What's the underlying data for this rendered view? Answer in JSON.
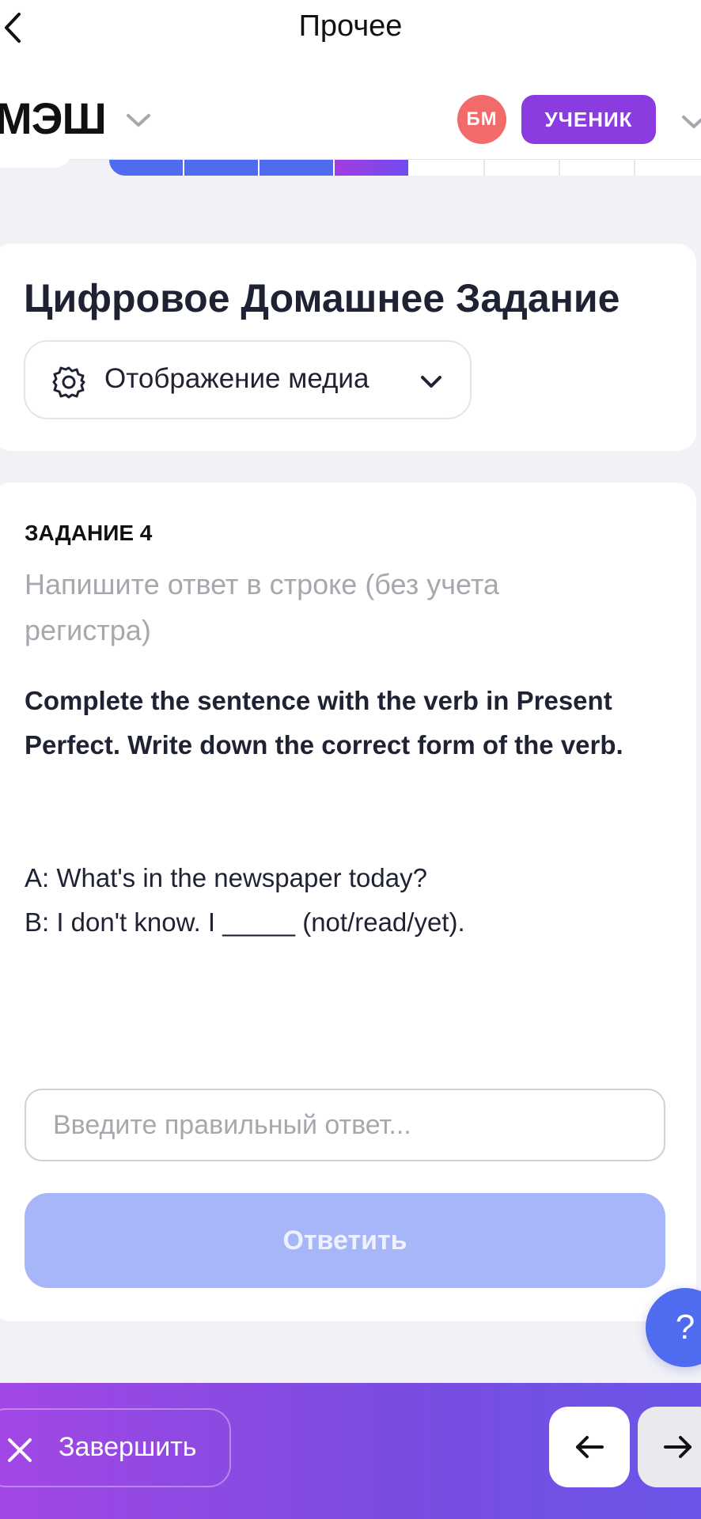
{
  "nav": {
    "title": "Прочее",
    "back_icon": "chevron-left-icon"
  },
  "header": {
    "logo_text": "МЭШ",
    "avatar_initials": "БМ",
    "role_label": "УЧЕНИК",
    "colors": {
      "avatar": "#F26A6A",
      "role_badge": "#8B3CE0"
    }
  },
  "progress": {
    "segments": [
      "done",
      "done",
      "done",
      "current",
      "todo",
      "todo",
      "todo",
      "todo"
    ],
    "colors": {
      "done": "#4F6CF0",
      "current_start": "#A33CE0"
    }
  },
  "homework": {
    "title": "Цифровое Домашнее Задание",
    "media_toggle_label": "Отображение медиа"
  },
  "task": {
    "number_label": "ЗАДАНИЕ 4",
    "hint": "Напишите ответ в строке (без учета регистра)",
    "instruction": "Complete the sentence with the verb in Present Perfect. Write down the correct form of the verb.",
    "dialogue": [
      "A: What's in the newspaper today?",
      "B: I don't know. I _____ (not/read/yet)."
    ],
    "answer_placeholder": "Введите правильный ответ...",
    "answer_value": "",
    "submit_label": "Ответить",
    "submit_disabled": true
  },
  "help": {
    "label": "?"
  },
  "footer": {
    "finish_label": "Завершить",
    "prev_icon": "arrow-left-icon",
    "next_icon": "arrow-right-icon",
    "gradient": [
      "#A247E5",
      "#6A55E8"
    ]
  }
}
